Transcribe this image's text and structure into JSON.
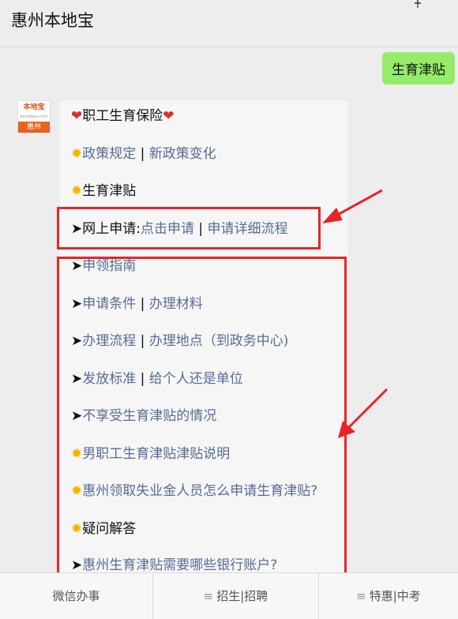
{
  "header": {
    "title": "惠州本地宝"
  },
  "user_message": "生育津贴",
  "avatar": {
    "brand": "本地宝",
    "domain": "bendibao.com",
    "city": "惠州"
  },
  "reply": {
    "title": "职工生育保险",
    "policy": {
      "link1": "政策规定",
      "sep": "|",
      "link2": "新政策变化"
    },
    "allowance": "生育津贴",
    "online": {
      "label": "网上申请:",
      "link1": "点击申请",
      "sep": "|",
      "link2": "申请详细流程"
    },
    "guide": "申领指南",
    "conditions": {
      "link1": "申请条件",
      "sep": "|",
      "link2": "办理材料"
    },
    "process": {
      "link1": "办理流程",
      "sep": "|",
      "link2": "办理地点（到政务中心)"
    },
    "standard": {
      "link1": "发放标准",
      "sep": "|",
      "link2": "给个人还是单位"
    },
    "excluded": "不享受生育津贴的情况",
    "male": "男职工生育津贴津贴说明",
    "unemployed": "惠州领取失业金人员怎么申请生育津贴?",
    "faq": "疑问解答",
    "bank": "惠州生育津贴需要哪些银行账户?"
  },
  "tabs": [
    {
      "label": "微信办事"
    },
    {
      "label": "招生|招聘"
    },
    {
      "label": "特惠|中考"
    }
  ],
  "glyphs": {
    "heart": "❤",
    "sun": "✹",
    "pointer": "➤",
    "menu": "≡"
  },
  "colors": {
    "link": "#576b95",
    "user_bubble": "#95ec69",
    "highlight": "#e8242a",
    "heart": "#e02e2e",
    "sun": "#f3b400"
  }
}
